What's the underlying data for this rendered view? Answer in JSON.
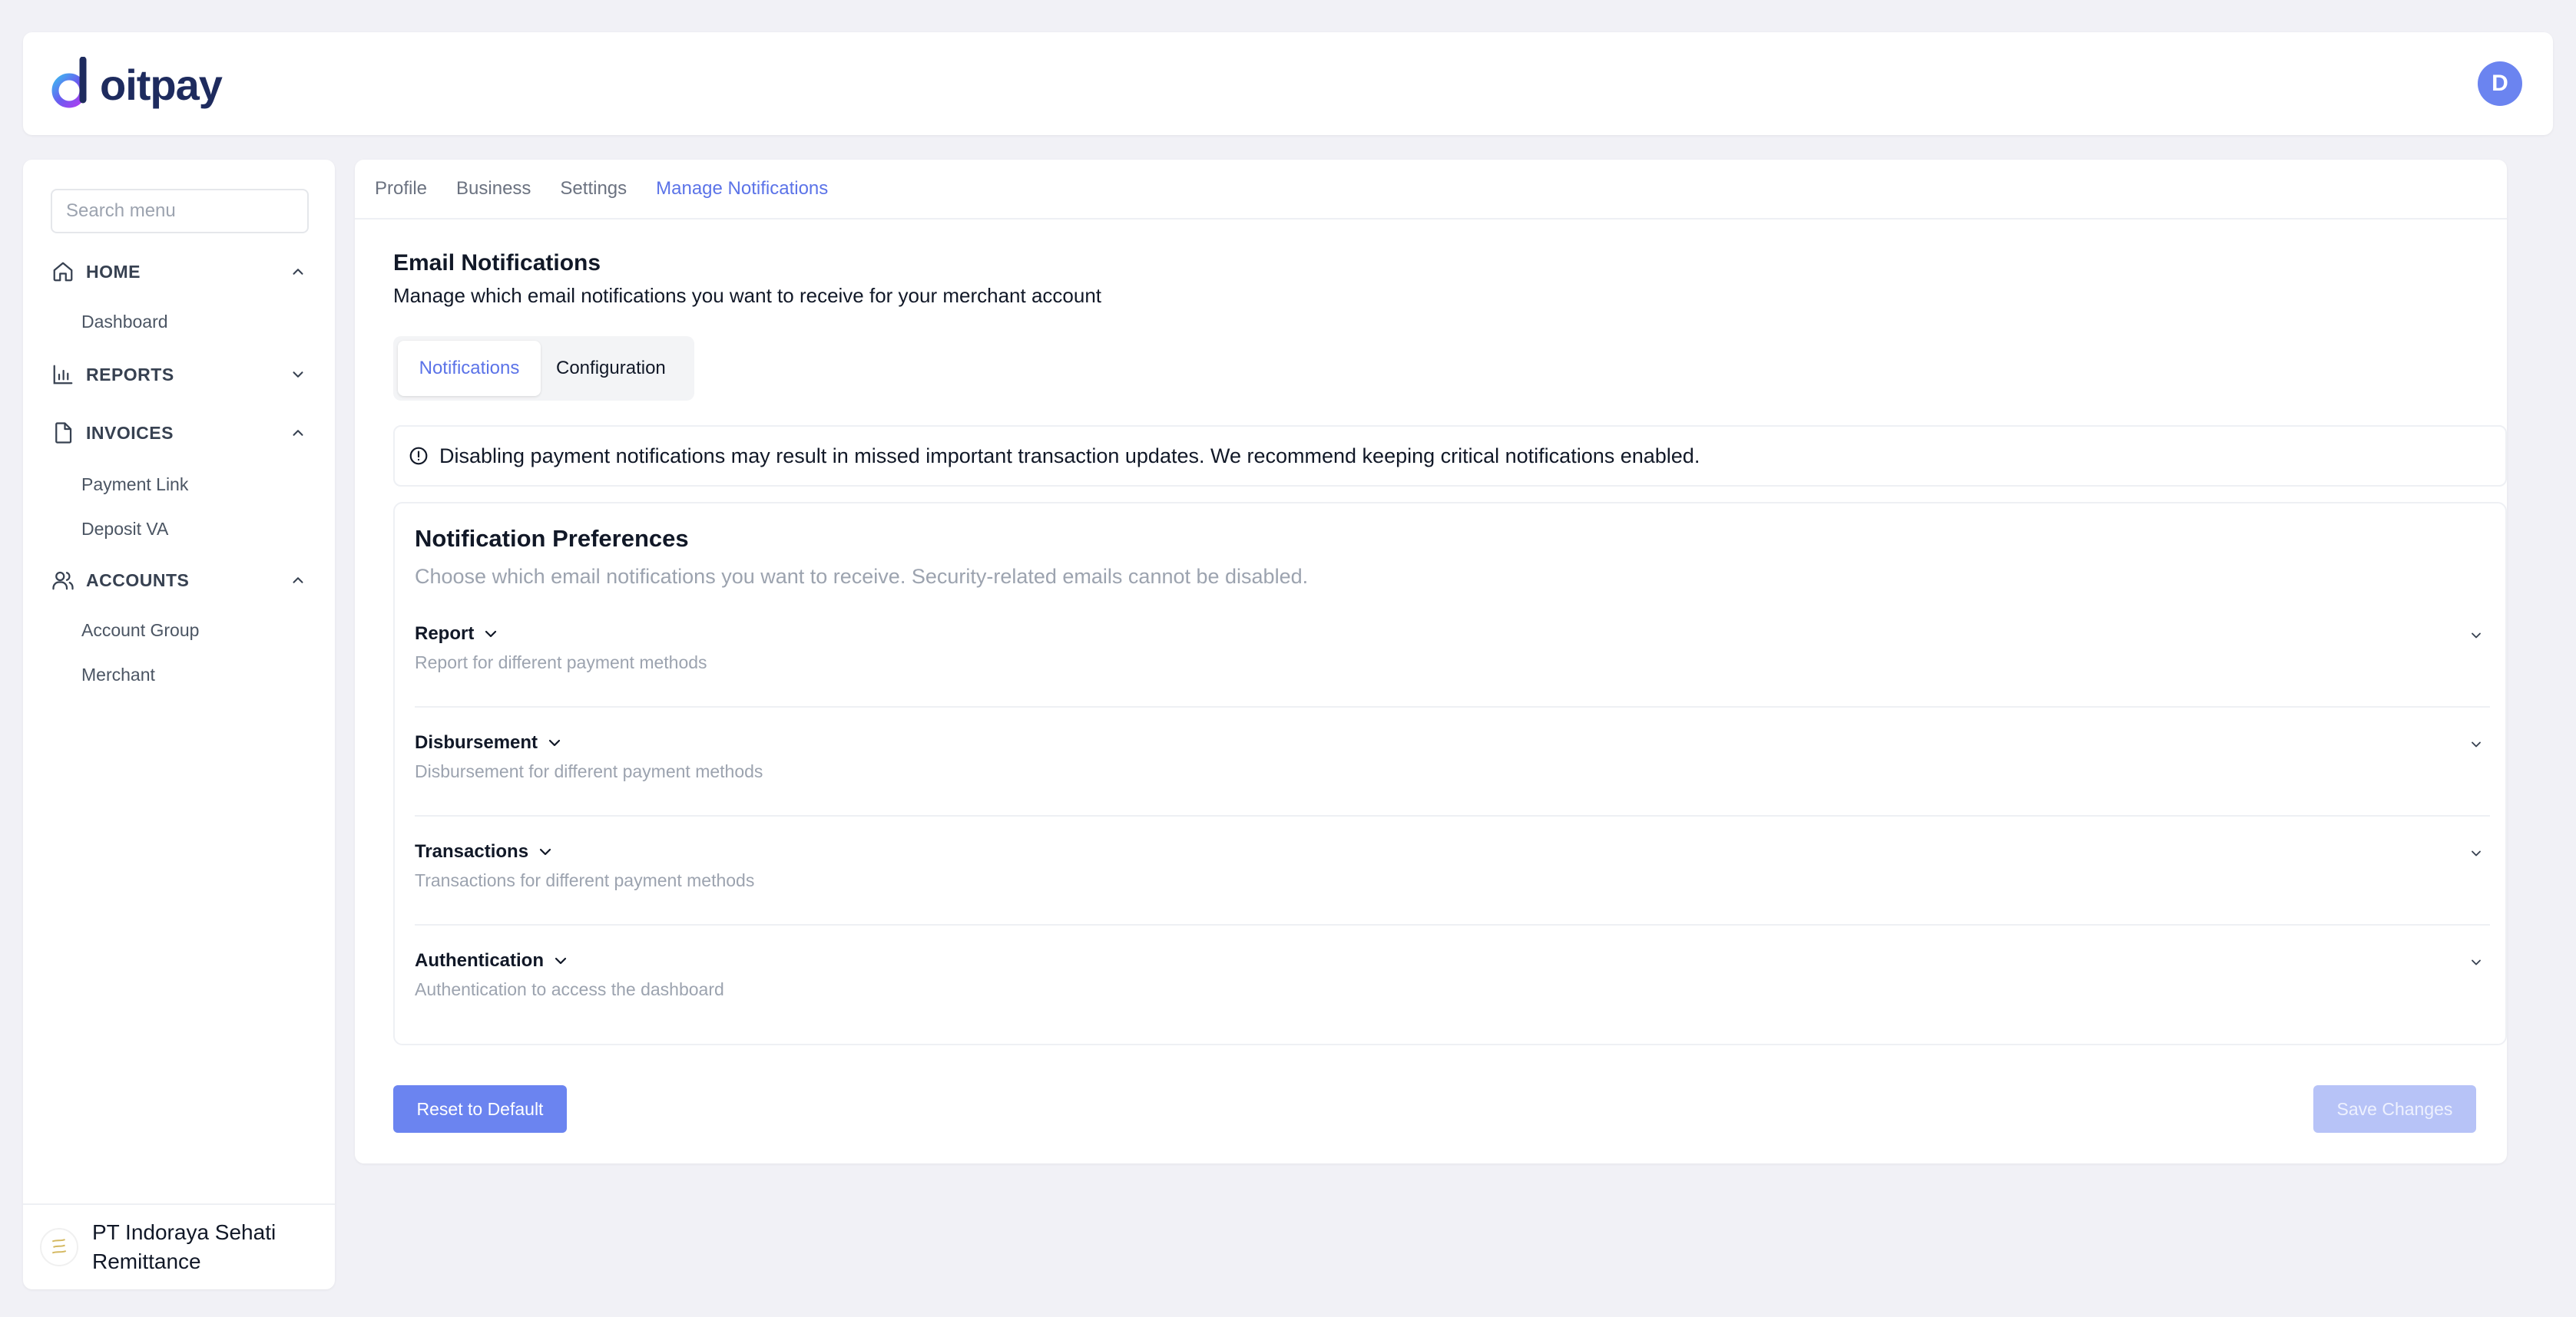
{
  "brand": {
    "name": "oitpay",
    "accent": "#5b73e8"
  },
  "user": {
    "initial": "D"
  },
  "sidebar": {
    "search_placeholder": "Search menu",
    "sections": [
      {
        "label": "HOME",
        "icon": "home-icon",
        "expanded": true,
        "items": [
          "Dashboard"
        ]
      },
      {
        "label": "REPORTS",
        "icon": "bar-chart-icon",
        "expanded": false,
        "items": []
      },
      {
        "label": "INVOICES",
        "icon": "document-icon",
        "expanded": true,
        "items": [
          "Payment Link",
          "Deposit VA"
        ]
      },
      {
        "label": "ACCOUNTS",
        "icon": "users-icon",
        "expanded": true,
        "items": [
          "Account Group",
          "Merchant"
        ]
      }
    ],
    "company": {
      "name": "PT Indoraya Sehati Remittance"
    }
  },
  "main": {
    "tabs": [
      {
        "label": "Profile",
        "active": false
      },
      {
        "label": "Business",
        "active": false
      },
      {
        "label": "Settings",
        "active": false
      },
      {
        "label": "Manage Notifications",
        "active": true
      }
    ],
    "title": "Email Notifications",
    "subtitle": "Manage which email notifications you want to receive for your merchant account",
    "segments": {
      "notifications": "Notifications",
      "configuration": "Configuration",
      "active": "Notifications"
    },
    "alert": "Disabling payment notifications may result in missed important transaction updates. We recommend keeping critical notifications enabled.",
    "preferences": {
      "title": "Notification Preferences",
      "subtitle": "Choose which email notifications you want to receive. Security-related emails cannot be disabled.",
      "rows": [
        {
          "title": "Report",
          "description": "Report for different payment methods"
        },
        {
          "title": "Disbursement",
          "description": "Disbursement for different payment methods"
        },
        {
          "title": "Transactions",
          "description": "Transactions for different payment methods"
        },
        {
          "title": "Authentication",
          "description": "Authentication to access the dashboard"
        }
      ]
    },
    "buttons": {
      "reset": "Reset to Default",
      "save": "Save Changes",
      "save_disabled": true
    }
  }
}
